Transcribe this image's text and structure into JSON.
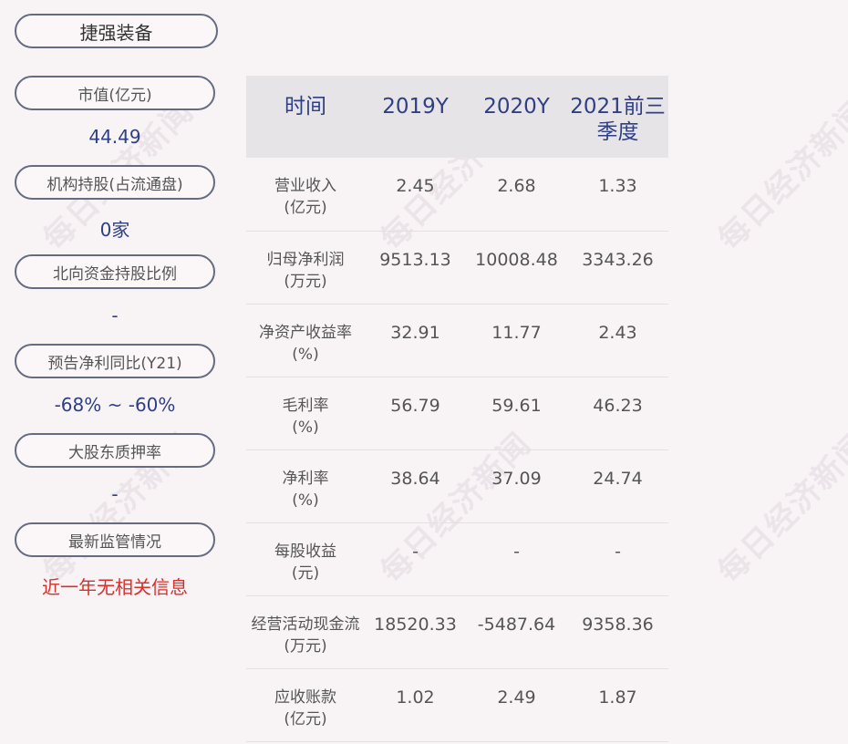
{
  "company": "捷强装备",
  "watermark": "每日经济新闻",
  "left_panel": [
    {
      "label": "市值(亿元)",
      "value": "44.49"
    },
    {
      "label": "机构持股(占流通盘)",
      "value": "0家"
    },
    {
      "label": "北向资金持股比例",
      "value": "-"
    },
    {
      "label": "预告净利同比(Y21)",
      "value": "-68% ~ -60%"
    },
    {
      "label": "大股东质押率",
      "value": "-"
    },
    {
      "label": "最新监管情况",
      "value": "近一年无相关信息"
    }
  ],
  "table": {
    "headers": [
      "时间",
      "2019Y",
      "2020Y",
      "2021前三季度"
    ],
    "rows": [
      {
        "metric": "营业收入",
        "unit": "(亿元)",
        "values": [
          "2.45",
          "2.68",
          "1.33"
        ]
      },
      {
        "metric": "归母净利润",
        "unit": "(万元)",
        "values": [
          "9513.13",
          "10008.48",
          "3343.26"
        ]
      },
      {
        "metric": "净资产收益率",
        "unit": "(%)",
        "values": [
          "32.91",
          "11.77",
          "2.43"
        ]
      },
      {
        "metric": "毛利率",
        "unit": "(%)",
        "values": [
          "56.79",
          "59.61",
          "46.23"
        ]
      },
      {
        "metric": "净利率",
        "unit": "(%)",
        "values": [
          "38.64",
          "37.09",
          "24.74"
        ]
      },
      {
        "metric": "每股收益",
        "unit": "(元)",
        "values": [
          "-",
          "-",
          "-"
        ]
      },
      {
        "metric": "经营活动现金流",
        "unit": "(万元)",
        "values": [
          "18520.33",
          "-5487.64",
          "9358.36"
        ]
      },
      {
        "metric": "应收账款",
        "unit": "(亿元)",
        "values": [
          "1.02",
          "2.49",
          "1.87"
        ]
      }
    ]
  },
  "colors": {
    "value_blue": "#2f3f85",
    "alert_red": "#d6302b",
    "header_bg": "#e7e4e8"
  }
}
